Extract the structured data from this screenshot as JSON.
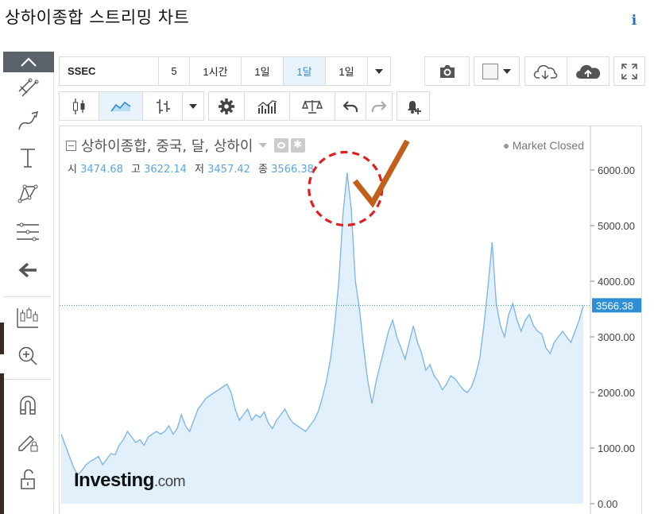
{
  "page": {
    "title": "상하이종합 스트리밍 차트"
  },
  "icons": {
    "info": "info-icon",
    "sidebar": [
      "chevron-up-icon",
      "crosshair-lines-icon",
      "brush-icon",
      "text-icon",
      "pattern-icon",
      "fibonacci-icon",
      "arrow-left-icon",
      "indicator-icon",
      "zoom-in-icon",
      "magnet-icon",
      "lock-pencil-icon",
      "unlock-icon"
    ]
  },
  "toolbar": {
    "symbol": "SSEC",
    "intervals": [
      "5",
      "1시간",
      "1일",
      "1달",
      "1일"
    ],
    "active_interval_index": 3
  },
  "chart": {
    "title": "상하이종합, 중국, 달, 상하이",
    "status": "Market Closed",
    "ohlc": {
      "open_label": "시",
      "open": "3474.68",
      "high_label": "고",
      "high": "3622.14",
      "low_label": "저",
      "low": "3457.42",
      "close_label": "종",
      "close": "3566.38"
    },
    "last_price_label": "3566.38",
    "watermark_brand": "Investing",
    "watermark_suffix": ".com",
    "colors": {
      "line": "#7fb8e6",
      "fill": "#e1f0fa",
      "accent": "#2f8fd4",
      "annotation_circle": "#e02020",
      "annotation_check": "#c0601a"
    }
  },
  "chart_data": {
    "type": "area",
    "yticks": [
      "6000.00",
      "5000.00",
      "4000.00",
      "3000.00",
      "2000.00",
      "1000.00",
      "0.00"
    ],
    "ylim": [
      0,
      6600
    ],
    "last_value": 3566.38,
    "y": [
      1250,
      1050,
      850,
      650,
      520,
      600,
      700,
      760,
      800,
      850,
      700,
      800,
      900,
      880,
      1050,
      1150,
      1300,
      1200,
      1100,
      1150,
      1050,
      1200,
      1250,
      1300,
      1250,
      1300,
      1400,
      1250,
      1350,
      1600,
      1400,
      1300,
      1500,
      1700,
      1800,
      1900,
      1950,
      2000,
      2050,
      2100,
      2150,
      2000,
      1700,
      1500,
      1600,
      1700,
      1500,
      1600,
      1550,
      1650,
      1450,
      1350,
      1500,
      1600,
      1700,
      1550,
      1450,
      1400,
      1350,
      1300,
      1400,
      1500,
      1650,
      1900,
      2200,
      2600,
      3200,
      4000,
      5200,
      5950,
      5300,
      4000,
      3500,
      2800,
      2200,
      1800,
      2200,
      2500,
      2800,
      3100,
      3300,
      3000,
      2800,
      2600,
      2900,
      3200,
      2900,
      2700,
      2400,
      2500,
      2300,
      2200,
      2050,
      2150,
      2300,
      2250,
      2150,
      2050,
      2000,
      2100,
      2300,
      2600,
      3200,
      3900,
      4700,
      3600,
      3200,
      3000,
      3400,
      3600,
      3300,
      3100,
      3300,
      3400,
      3200,
      3100,
      3050,
      2800,
      2700,
      2900,
      3000,
      3100,
      3000,
      2900,
      3100,
      3300,
      3566
    ]
  },
  "annotations": {
    "circle": "red-dashed-circle",
    "check": "orange-checkmark"
  }
}
